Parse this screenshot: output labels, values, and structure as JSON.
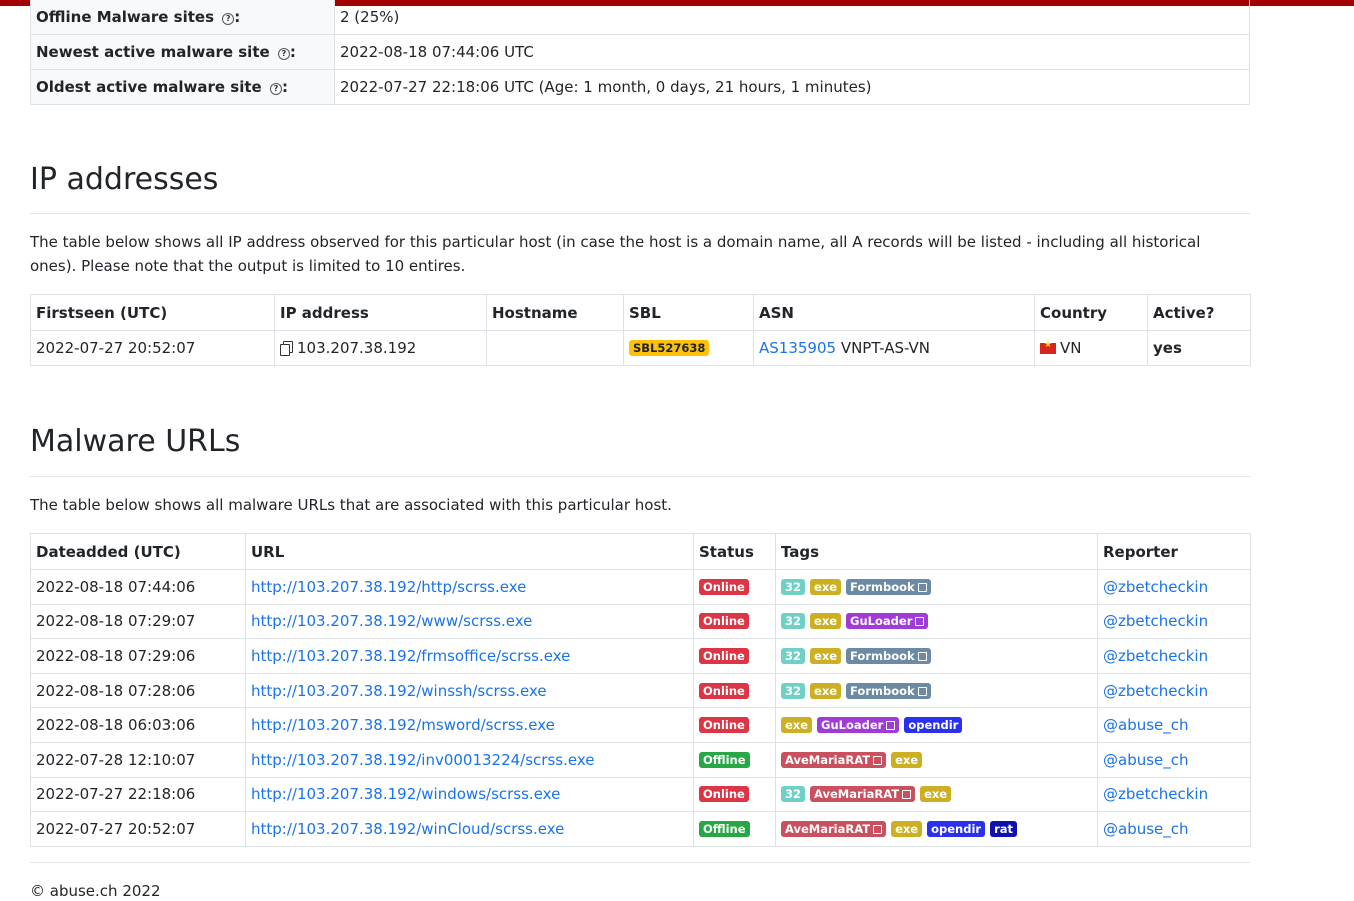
{
  "stats": [
    {
      "label": "Offline Malware sites",
      "value": "2 (25%)"
    },
    {
      "label": "Newest active malware site",
      "value": "2022-08-18 07:44:06 UTC"
    },
    {
      "label": "Oldest active malware site",
      "value": "2022-07-27 22:18:06 UTC (Age: 1 month, 0 days, 21 hours, 1 minutes)"
    }
  ],
  "ip_section": {
    "title": "IP addresses",
    "description": "The table below shows all IP address observed for this particular host (in case the host is a domain name, all A records will be listed - including all historical ones). Please note that the output is limited to 10 entires.",
    "headers": [
      "Firstseen (UTC)",
      "IP address",
      "Hostname",
      "SBL",
      "ASN",
      "Country",
      "Active?"
    ],
    "row": {
      "firstseen": "2022-07-27 20:52:07",
      "ip": "103.207.38.192",
      "hostname": "",
      "sbl": "SBL527638",
      "asn_link": "AS135905",
      "asn_name": "VNPT-AS-VN",
      "country": "VN",
      "active": "yes"
    }
  },
  "url_section": {
    "title": "Malware URLs",
    "description": "The table below shows all malware URLs that are associated with this particular host.",
    "headers": [
      "Dateadded (UTC)",
      "URL",
      "Status",
      "Tags",
      "Reporter"
    ],
    "rows": [
      {
        "date": "2022-08-18 07:44:06",
        "url": "http://103.207.38.192/http/scrss.exe",
        "status": "Online",
        "tags": [
          "32",
          "exe",
          "Formbook"
        ],
        "reporter": "@zbetcheckin"
      },
      {
        "date": "2022-08-18 07:29:07",
        "url": "http://103.207.38.192/www/scrss.exe",
        "status": "Online",
        "tags": [
          "32",
          "exe",
          "GuLoader"
        ],
        "reporter": "@zbetcheckin"
      },
      {
        "date": "2022-08-18 07:29:06",
        "url": "http://103.207.38.192/frmsoffice/scrss.exe",
        "status": "Online",
        "tags": [
          "32",
          "exe",
          "Formbook"
        ],
        "reporter": "@zbetcheckin"
      },
      {
        "date": "2022-08-18 07:28:06",
        "url": "http://103.207.38.192/winssh/scrss.exe",
        "status": "Online",
        "tags": [
          "32",
          "exe",
          "Formbook"
        ],
        "reporter": "@zbetcheckin"
      },
      {
        "date": "2022-08-18 06:03:06",
        "url": "http://103.207.38.192/msword/scrss.exe",
        "status": "Online",
        "tags": [
          "exe",
          "GuLoader",
          "opendir"
        ],
        "reporter": "@abuse_ch"
      },
      {
        "date": "2022-07-28 12:10:07",
        "url": "http://103.207.38.192/inv00013224/scrss.exe",
        "status": "Offline",
        "tags": [
          "AveMariaRAT",
          "exe"
        ],
        "reporter": "@abuse_ch"
      },
      {
        "date": "2022-07-27 22:18:06",
        "url": "http://103.207.38.192/windows/scrss.exe",
        "status": "Online",
        "tags": [
          "32",
          "AveMariaRAT",
          "exe"
        ],
        "reporter": "@zbetcheckin"
      },
      {
        "date": "2022-07-27 20:52:07",
        "url": "http://103.207.38.192/winCloud/scrss.exe",
        "status": "Offline",
        "tags": [
          "AveMariaRAT",
          "exe",
          "opendir",
          "rat"
        ],
        "reporter": "@abuse_ch"
      }
    ]
  },
  "tag_colors": {
    "32": "#6fd0c7",
    "exe": "#ccaf22",
    "Formbook": "#6c8aa5",
    "GuLoader": "#a13bd6",
    "opendir": "#2a30f0",
    "AveMariaRAT": "#c9505e",
    "rat": "#1010b0"
  },
  "footer": "© abuse.ch 2022"
}
